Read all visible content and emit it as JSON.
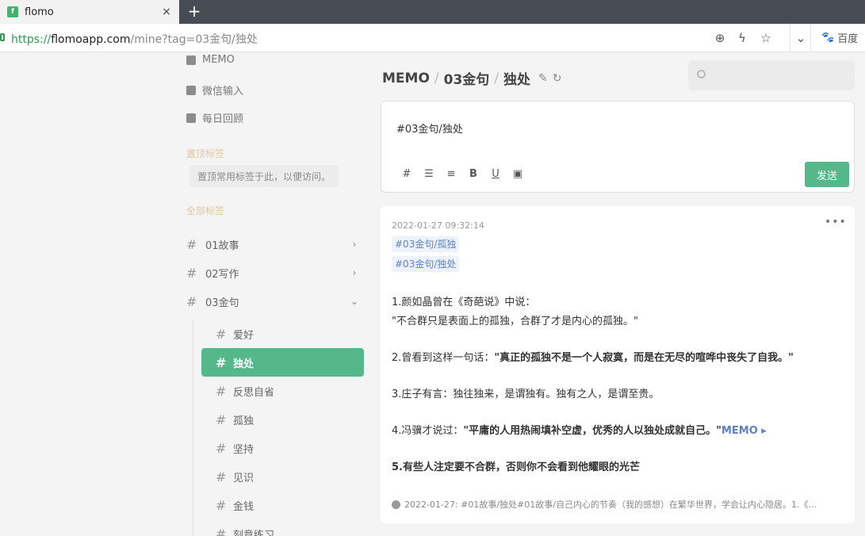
{
  "browser": {
    "tab_title": "flomo",
    "favicon": "f",
    "close_glyph": "×",
    "new_tab_glyph": "+",
    "url_scheme": "https://",
    "url_host": "flomoapp.com",
    "url_path": "/mine?tag=03金句/独处",
    "search_engine": "百度"
  },
  "sidebar": {
    "nav": [
      {
        "label": "MEMO"
      },
      {
        "label": "微信输入"
      },
      {
        "label": "每日回顾"
      }
    ],
    "pinned_title": "置顶标签",
    "pinned_hint": "置顶常用标签于此，以便访问。",
    "all_tags_title": "全部标签",
    "tags": [
      {
        "label": "01故事",
        "chevron": "›"
      },
      {
        "label": "02写作",
        "chevron": "›"
      },
      {
        "label": "03金句",
        "chevron": "⌄"
      }
    ],
    "subtags": [
      {
        "label": "爱好"
      },
      {
        "label": "独处"
      },
      {
        "label": "反思自省"
      },
      {
        "label": "孤独"
      },
      {
        "label": "坚持"
      },
      {
        "label": "见识"
      },
      {
        "label": "金钱"
      },
      {
        "label": "刻意练习"
      }
    ],
    "active_subtag": "独处"
  },
  "header": {
    "crumb1": "MEMO",
    "crumb2": "03金句",
    "crumb3": "独处",
    "sep": "/"
  },
  "search": {
    "placeholder": ""
  },
  "editor": {
    "content": "#03金句/独处",
    "tools": [
      "#",
      "☰",
      "≡",
      "B",
      "U",
      "▣"
    ],
    "send_label": "发送"
  },
  "memo": {
    "time": "2022-01-27 09:32:14",
    "more": "•••",
    "tags": [
      "#03金句/孤独",
      "#03金句/独处"
    ],
    "line1": "1.颜如晶曾在《奇葩说》中说：",
    "line2": "\"不合群只是表面上的孤独，合群了才是内心的孤独。\"",
    "line3_prefix": "2.曾看到这样一句话：",
    "line3_bold": "\"真正的孤独不是一个人寂寞，而是在无尽的喧哗中丧失了自我。\"",
    "line4": "3.庄子有言：独往独来，是谓独有。独有之人，是谓至贵。",
    "line5_prefix": "4.冯骥才说过：",
    "line5_bold": "\"平庸的人用热闹填补空虚，优秀的人以独处成就自己。\"",
    "line5_link": "MEMO ▸",
    "line6": "5.有些人注定要不合群，否则你不会看到他耀眼的光芒",
    "footer": "2022-01-27: #01故事/独处#01故事/自己内心的节奏（我的感想）在繁华世界，学会让内心隐居。1.《..."
  },
  "colors": {
    "accent": "#55b88b",
    "tag": "#5e80c6",
    "section": "#e1c7a0"
  }
}
